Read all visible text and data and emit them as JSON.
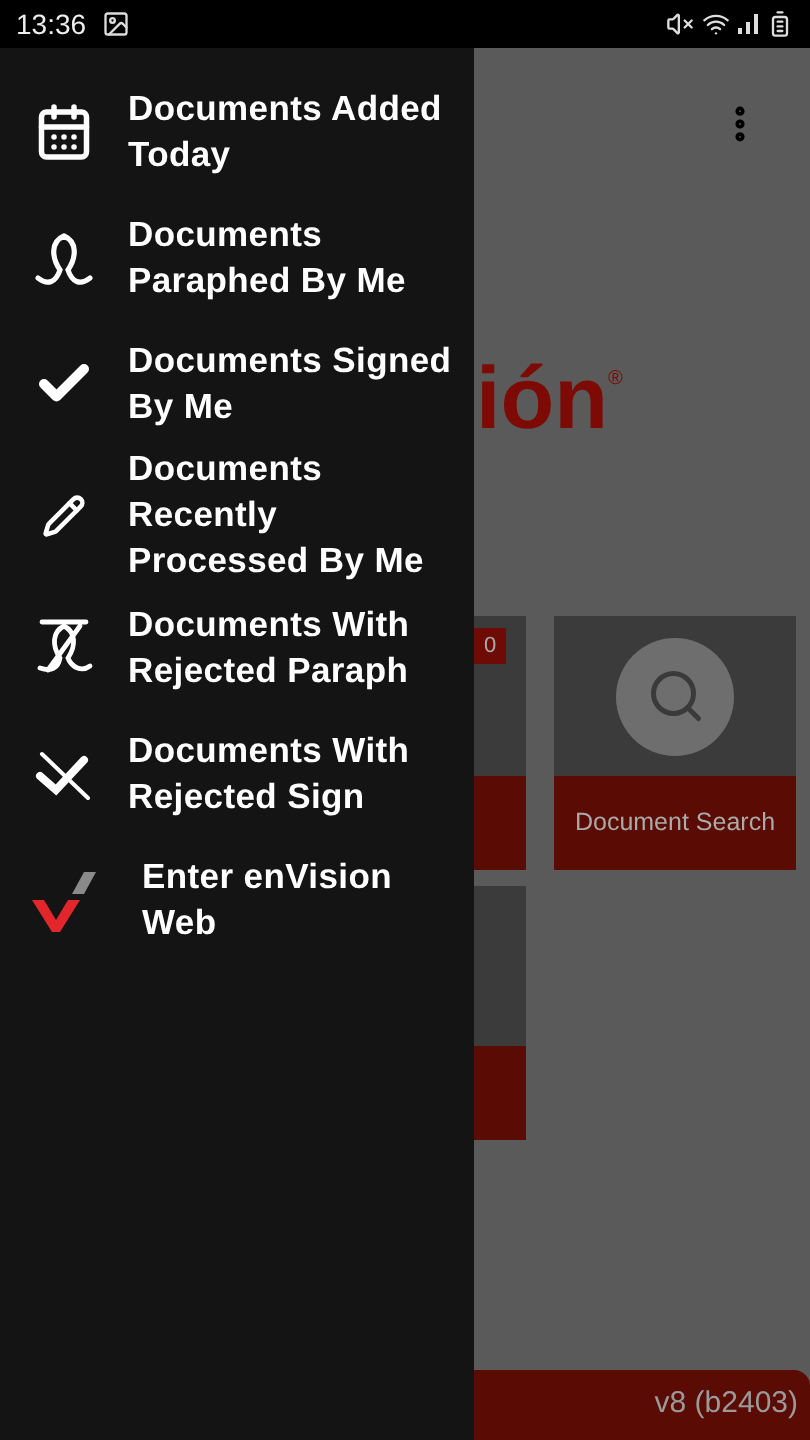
{
  "status_bar": {
    "time": "13:36"
  },
  "drawer": {
    "items": [
      {
        "kind": "calendar",
        "label": "Documents Added Today"
      },
      {
        "kind": "paraph",
        "label": "Documents Paraphed By Me"
      },
      {
        "kind": "check",
        "label": "Documents Signed By Me"
      },
      {
        "kind": "pencil",
        "label": "Documents Recently Processed By Me"
      },
      {
        "kind": "rejected-paraph",
        "label": "Documents With Rejected Paraph"
      },
      {
        "kind": "rejected-sign",
        "label": "Documents With Rejected Sign"
      },
      {
        "kind": "web",
        "label": "Enter enVision Web"
      }
    ]
  },
  "background": {
    "logo": "ión",
    "logo_mark": "®",
    "tiles": [
      {
        "kind": "partial",
        "badge": "0"
      },
      {
        "kind": "search",
        "label": "Document Search"
      },
      {
        "kind": "partial"
      }
    ],
    "footer": {
      "version": "v8 (b2403)"
    }
  }
}
